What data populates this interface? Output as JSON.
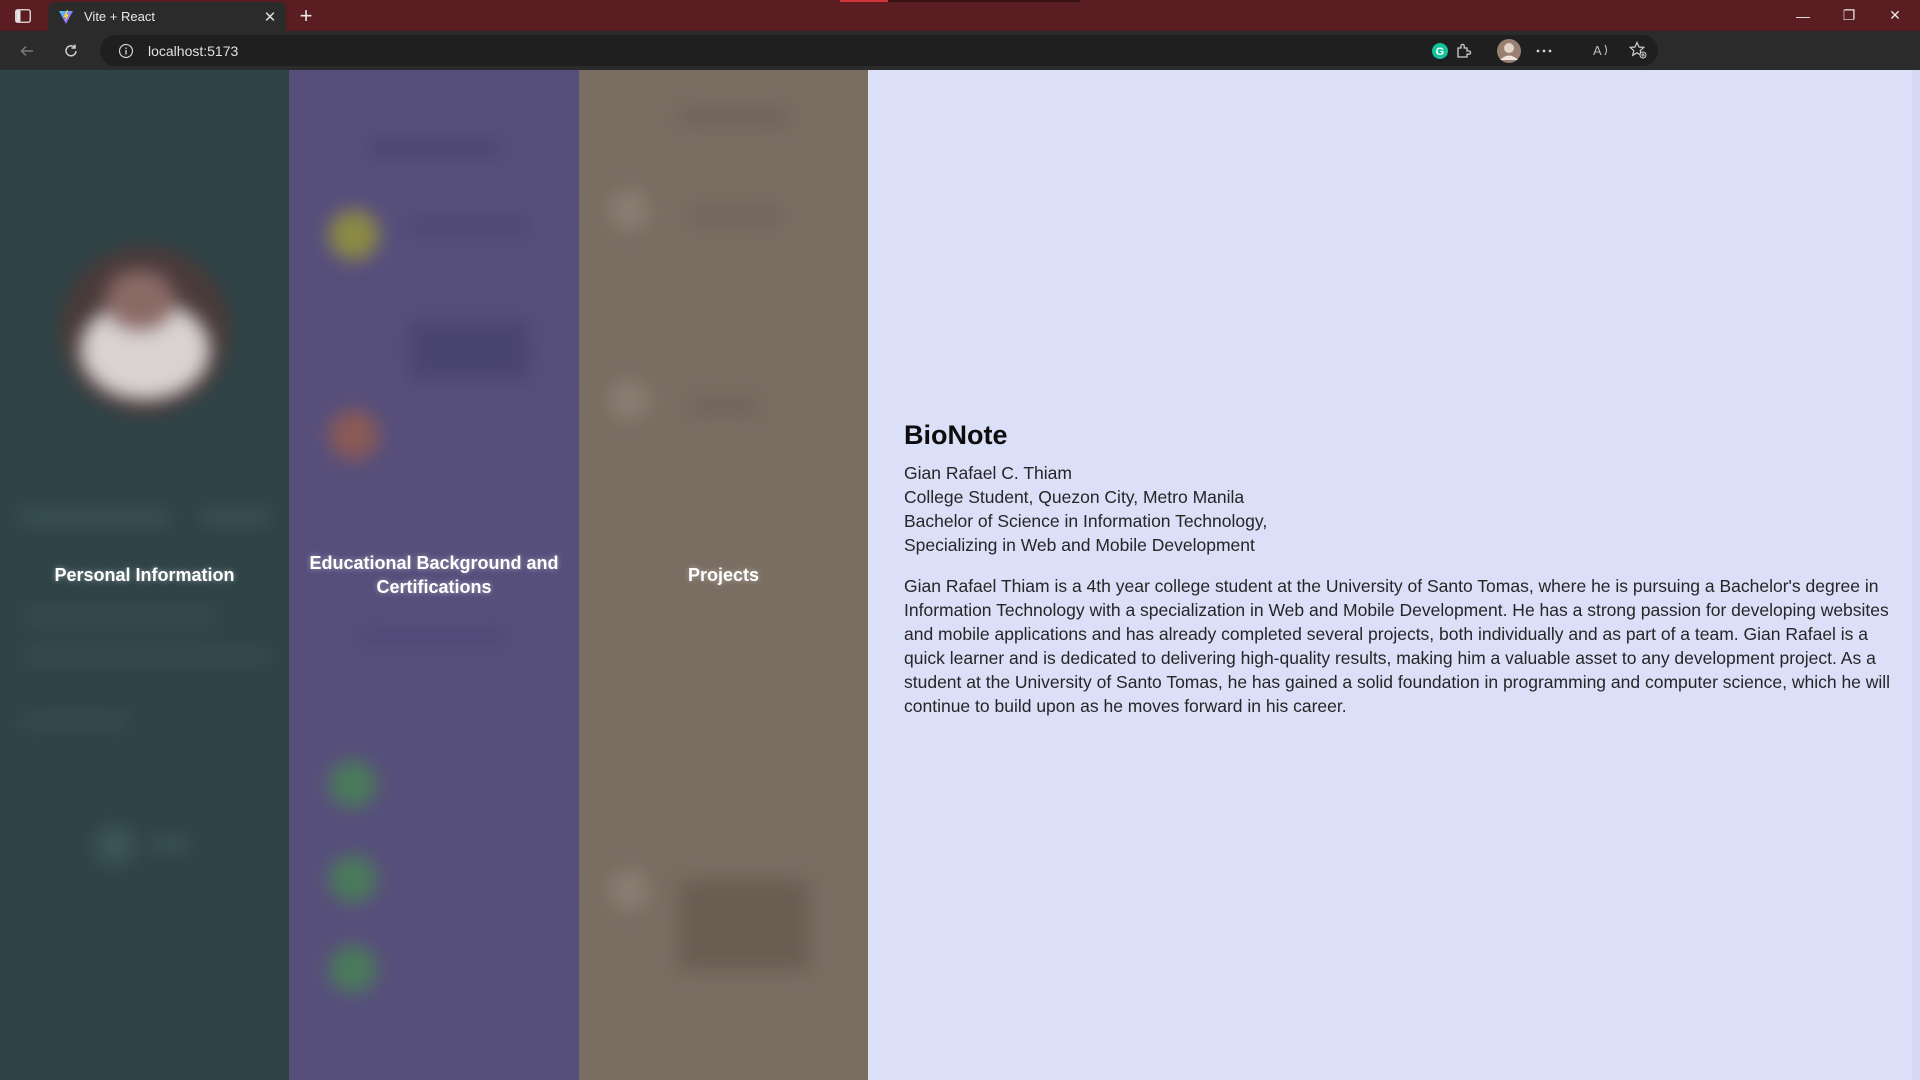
{
  "browser": {
    "tab_title": "Vite + React",
    "new_tab_symbol": "+",
    "close_symbol": "✕",
    "url": "localhost:5173",
    "controls": {
      "minimize": "—",
      "restore": "❐",
      "close": "✕"
    }
  },
  "panels": [
    {
      "title": "Personal Information",
      "color": "#2f4447"
    },
    {
      "title": "Educational Background and Certifications",
      "color": "#574f7b"
    },
    {
      "title": "Projects",
      "color": "#7a6d62"
    }
  ],
  "bionote": {
    "heading": "BioNote",
    "lines": [
      "Gian Rafael C. Thiam",
      "College Student, Quezon City, Metro Manila",
      "Bachelor of Science in Information Technology,",
      "Specializing in Web and Mobile Development"
    ],
    "paragraph": "Gian Rafael Thiam is a 4th year college student at the University of Santo Tomas, where he is pursuing a Bachelor's degree in Information Technology with a specialization in Web and Mobile Development. He has a strong passion for developing websites and mobile applications and has already completed several projects, both individually and as part of a team. Gian Rafael is a quick learner and is dedicated to delivering high-quality results, making him a valuable asset to any development project. As a student at the University of Santo Tomas, he has gained a solid foundation in programming and computer science, which he will continue to build upon as he moves forward in his career."
  },
  "icons": {
    "tab_favicon": "vite-logo-icon",
    "sidebar": "sidebar-toggle-icon",
    "back": "back-arrow-icon",
    "reload": "reload-icon",
    "site_info": "info-icon",
    "read_aloud": "read-aloud-icon",
    "favorites": "add-favorite-icon",
    "grammarly": "grammarly-icon",
    "extensions": "extensions-icon",
    "profile": "profile-avatar",
    "menu": "more-menu-icon"
  },
  "colors": {
    "titlebar": "#5a1e22",
    "toolbar": "#2b2b2b",
    "page_background": "#dcdff8"
  }
}
